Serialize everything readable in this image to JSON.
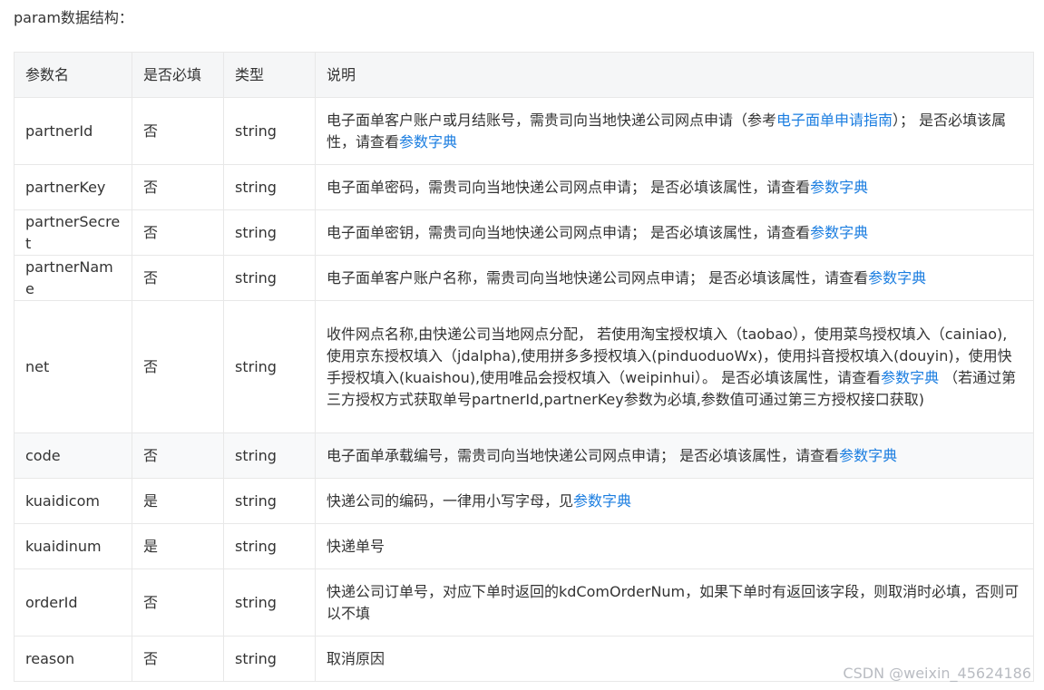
{
  "heading": "param数据结构：",
  "columns": [
    "参数名",
    "是否必填",
    "类型",
    "说明"
  ],
  "link_color": "#1a7de0",
  "rows": [
    {
      "name": "partnerId",
      "required": "否",
      "type": "string",
      "desc_before": "电子面单客户账户或月结账号，需贵司向当地快递公司网点申请（参考",
      "desc_link1": "电子面单申请指南",
      "desc_middle": "）； 是否必填该属性，请查看",
      "desc_link2": "参数字典",
      "desc_after": ""
    },
    {
      "name": "partnerKey",
      "required": "否",
      "type": "string",
      "desc_before": "电子面单密码，需贵司向当地快递公司网点申请； 是否必填该属性，请查看",
      "desc_link": "参数字典"
    },
    {
      "name": "partnerSecret",
      "required": "否",
      "type": "string",
      "desc_before": "电子面单密钥，需贵司向当地快递公司网点申请； 是否必填该属性，请查看",
      "desc_link": "参数字典"
    },
    {
      "name": "partnerName",
      "required": "否",
      "type": "string",
      "desc_before": "电子面单客户账户名称，需贵司向当地快递公司网点申请； 是否必填该属性，请查看",
      "desc_link": "参数字典"
    },
    {
      "name": "net",
      "required": "否",
      "type": "string",
      "desc_before": "收件网点名称,由快递公司当地网点分配， 若使用淘宝授权填入（taobao），使用菜鸟授权填入（cainiao), 使用京东授权填入（jdalpha),使用拼多多授权填入(pinduoduoWx)，使用抖音授权填入(douyin)，使用快手授权填入(kuaishou),使用唯品会授权填入（weipinhui）。 是否必填该属性，请查看",
      "desc_link": "参数字典",
      "desc_after": " （若通过第三方授权方式获取单号partnerId,partnerKey参数为必填,参数值可通过第三方授权接口获取)"
    },
    {
      "name": "code",
      "required": "否",
      "type": "string",
      "desc_before": "电子面单承载编号，需贵司向当地快递公司网点申请； 是否必填该属性，请查看",
      "desc_link": "参数字典"
    },
    {
      "name": "kuaidicom",
      "required": "是",
      "type": "string",
      "desc_before": "快递公司的编码，一律用小写字母，见",
      "desc_link": "参数字典"
    },
    {
      "name": "kuaidinum",
      "required": "是",
      "type": "string",
      "desc_before": "快递单号"
    },
    {
      "name": "orderId",
      "required": "否",
      "type": "string",
      "desc_before": "快递公司订单号，对应下单时返回的kdComOrderNum，如果下单时有返回该字段，则取消时必填，否则可以不填"
    },
    {
      "name": "reason",
      "required": "否",
      "type": "string",
      "desc_before": "取消原因"
    }
  ],
  "watermark": "CSDN @weixin_45624186"
}
